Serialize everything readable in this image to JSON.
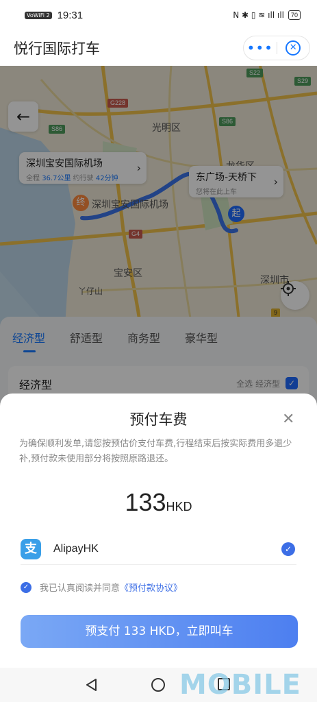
{
  "status_bar": {
    "wifi_badge": "VoWiFi 2",
    "time": "19:31",
    "indicators": "N ✱ ▯ ≋ ıll ıll",
    "battery": "70"
  },
  "header": {
    "title": "悦行国际打车",
    "more_label": "•••",
    "close_label": "✕"
  },
  "map": {
    "destination_card": {
      "name": "深圳宝安国际机场",
      "distance_prefix": "全程",
      "distance": "36.7公里",
      "time_prefix": "约行驶",
      "time": "42分钟"
    },
    "pickup_card": {
      "name": "东广场-天桥下",
      "hint": "您将在此上车"
    },
    "labels": {
      "guangming": "光明区",
      "longhua": "龙华区",
      "airport": "深圳宝安国际机场",
      "baoan": "宝安区",
      "shenzhen": "深圳市",
      "zaishan": "丫仔山"
    },
    "roads": {
      "g228": "G228",
      "s86a": "S86",
      "s86b": "S86",
      "s22": "S22",
      "s29": "S29",
      "g4": "G4"
    },
    "end_pin": "终",
    "start_pin": "起",
    "traffic_sign": "9"
  },
  "tabs": [
    "经济型",
    "舒适型",
    "商务型",
    "豪华型"
  ],
  "class_card": {
    "name": "经济型",
    "select_all": "全选 经济型"
  },
  "sheet": {
    "title": "预付车费",
    "description": "为确保顺利发单,请您按预估价支付车费,行程结束后按实际费用多退少补,预付款未使用部分将按照原路退还。",
    "amount": "133",
    "currency": "HKD",
    "payment_method": "AlipayHK",
    "alipay_logo": "支",
    "agreement_prefix": "我已认真阅读并同意",
    "agreement_link": "《预付款协议》",
    "cta": "预支付 133 HKD，立即叫车"
  },
  "watermark": "MOBILE",
  "colors": {
    "accent": "#1677ff",
    "cta_start": "#7aa8f5",
    "cta_end": "#4d7ff0",
    "route": "#3c74e8"
  }
}
